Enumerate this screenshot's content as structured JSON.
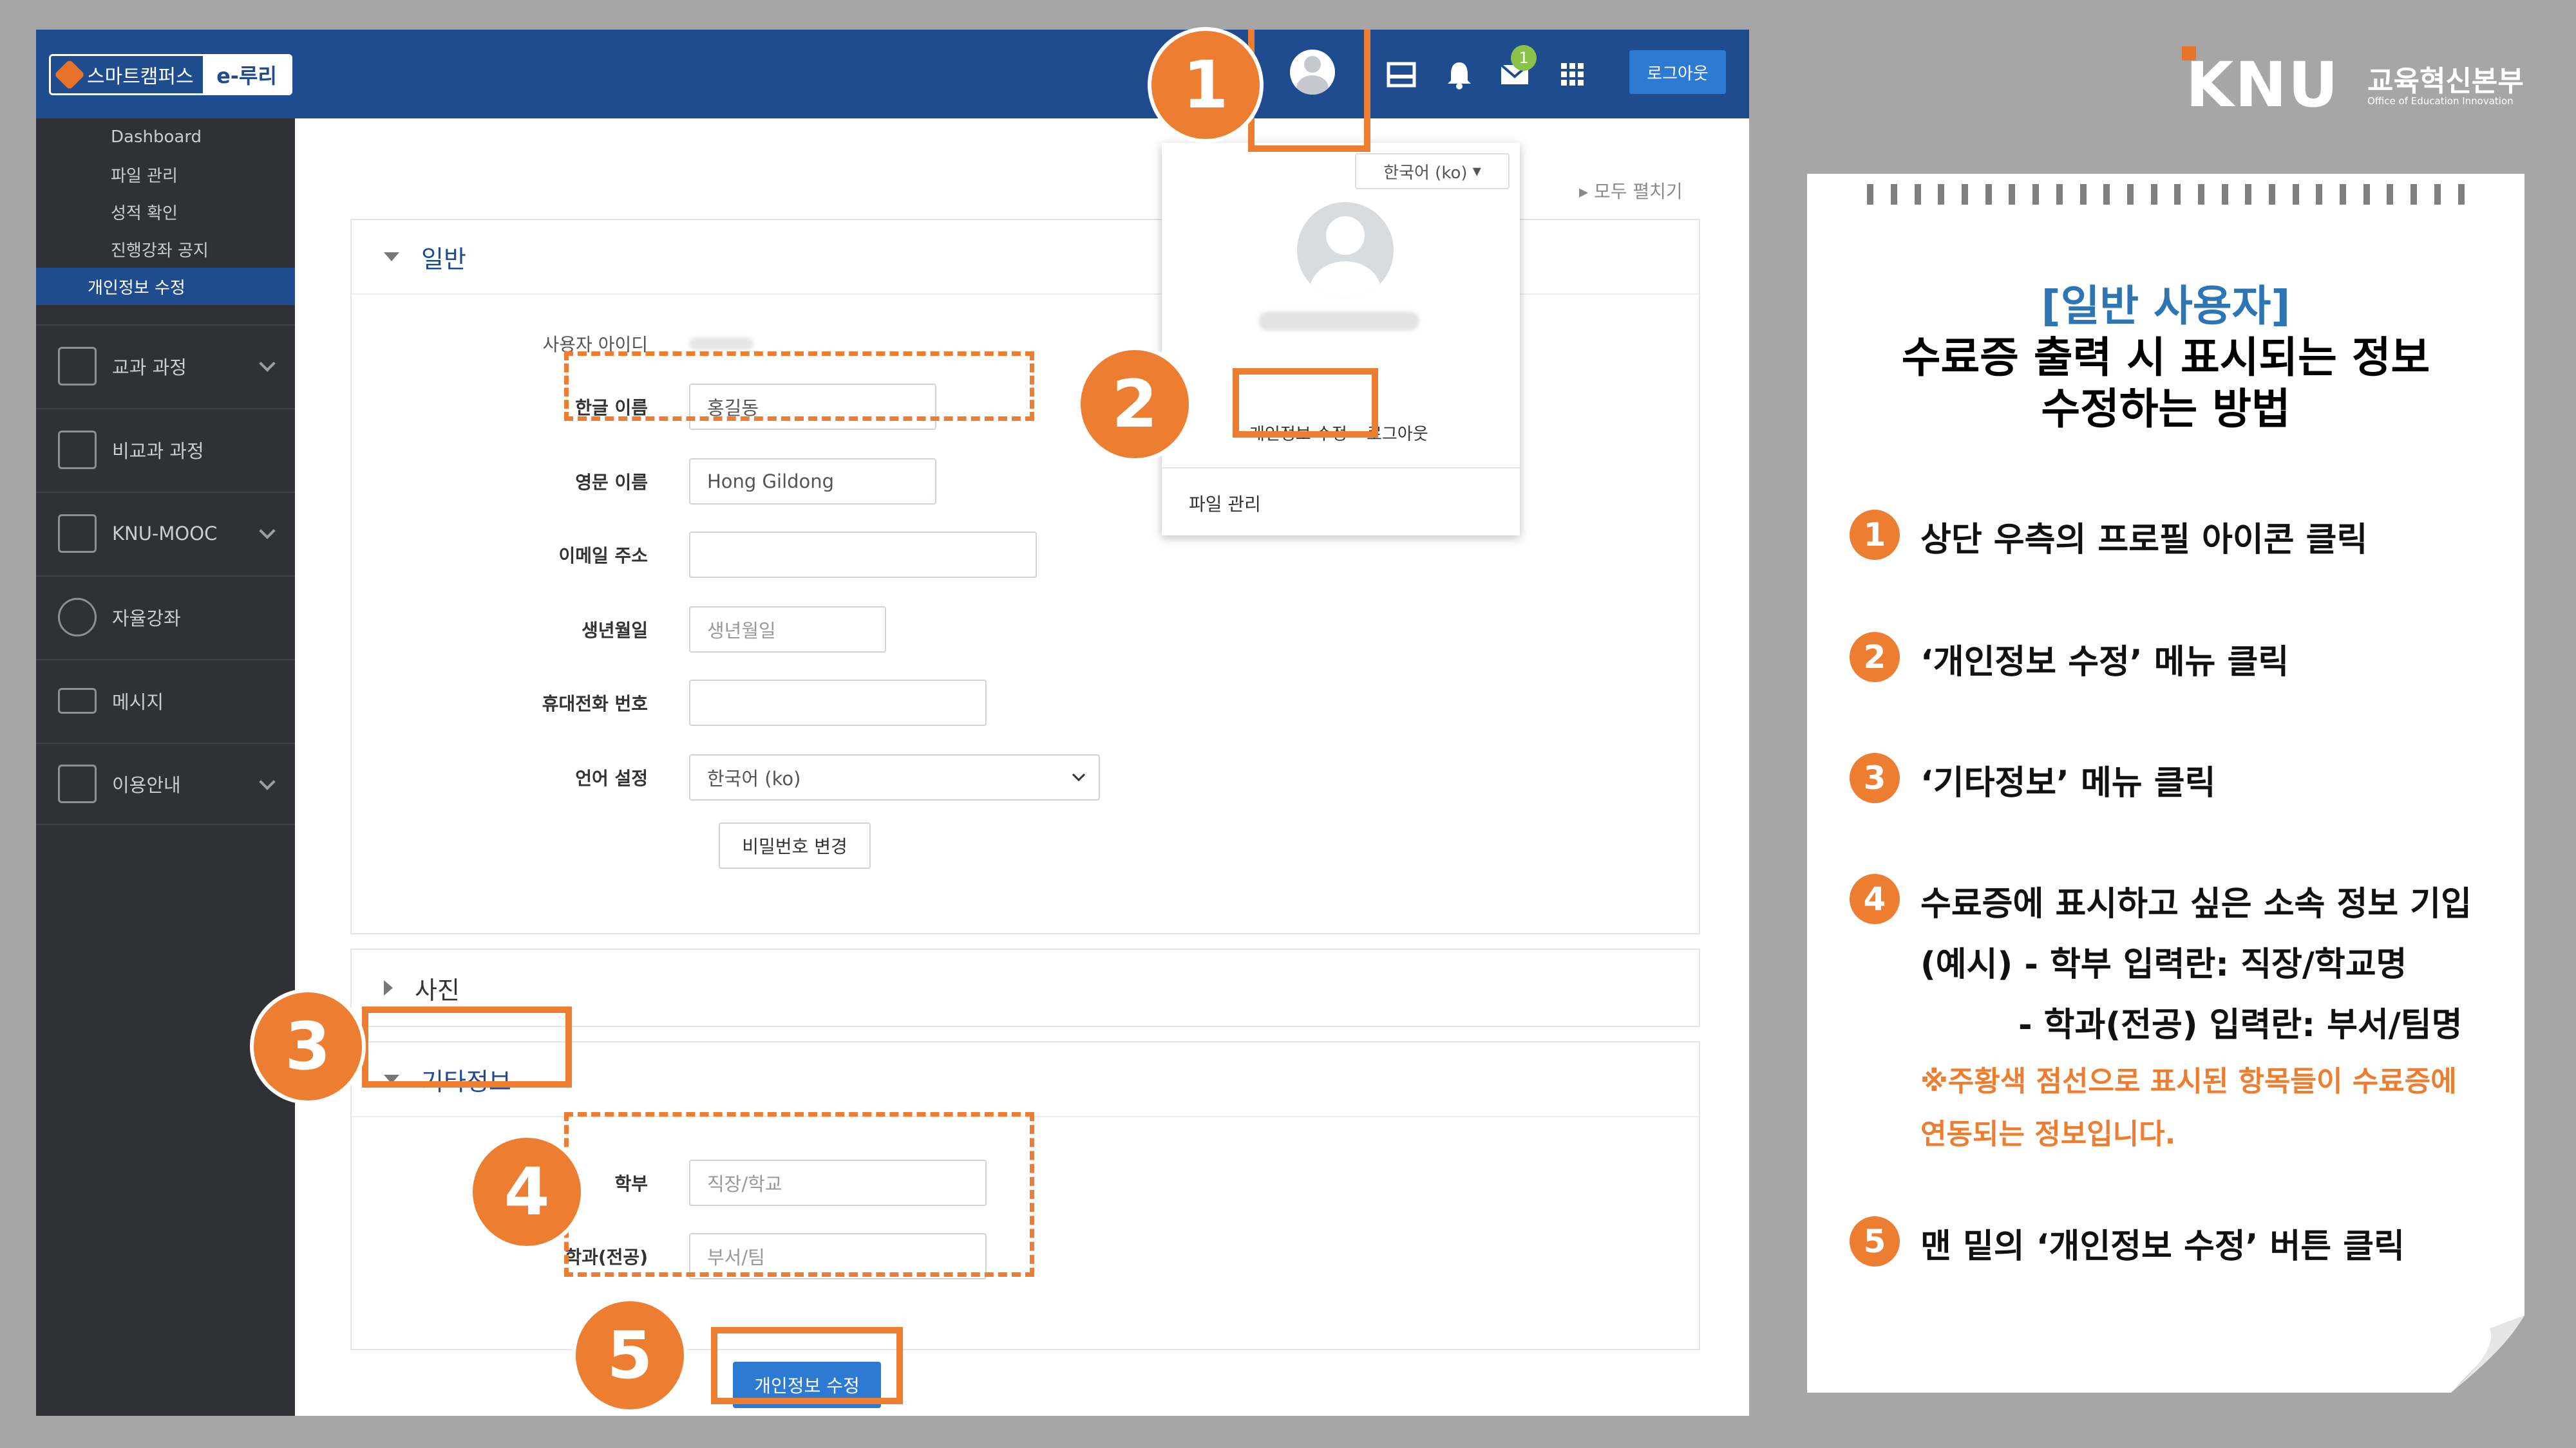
{
  "header": {
    "logo_text": "스마트캠퍼스",
    "logo_brand": "e-루리",
    "logout_label": "로그아웃",
    "message_badge": "1"
  },
  "sidebar": {
    "sub_items": [
      {
        "label": "Dashboard"
      },
      {
        "label": "파일 관리"
      },
      {
        "label": "성적 확인"
      },
      {
        "label": "진행강좌 공지"
      },
      {
        "label": "개인정보 수정",
        "active": true
      }
    ],
    "nav_items": [
      {
        "label": "교과 과정",
        "icon": "book-icon",
        "expandable": true
      },
      {
        "label": "비교과 과정",
        "icon": "open-book-icon",
        "expandable": false
      },
      {
        "label": "KNU-MOOC",
        "icon": "monitor-icon",
        "expandable": true
      },
      {
        "label": "자율강좌",
        "icon": "people-icon",
        "expandable": false
      },
      {
        "label": "메시지",
        "icon": "envelope-icon",
        "expandable": false
      },
      {
        "label": "이용안내",
        "icon": "map-icon",
        "expandable": true
      }
    ]
  },
  "main": {
    "expand_all": "모두 펼치기",
    "section_general": "일반",
    "section_photo": "사진",
    "section_other": "기타정보",
    "fields": {
      "user_id_label": "사용자 아이디",
      "korean_name_label": "한글 이름",
      "korean_name_value": "홍길동",
      "english_name_label": "영문 이름",
      "english_name_value": "Hong Gildong",
      "email_label": "이메일 주소",
      "birthday_label": "생년월일",
      "birthday_placeholder": "생년월일",
      "phone_label": "휴대전화 번호",
      "language_label": "언어 설정",
      "language_value": "한국어 (ko)",
      "password_button": "비밀번호 변경",
      "dept_label": "학부",
      "dept_placeholder": "직장/학교",
      "major_label": "학과(전공)",
      "major_placeholder": "부서/팀"
    },
    "save_button": "개인정보 수정"
  },
  "dropdown": {
    "language": "한국어 (ko)",
    "edit_profile": "개인정보 수정",
    "logout": "로그아웃",
    "file_manage": "파일 관리"
  },
  "callouts": [
    "1",
    "2",
    "3",
    "4",
    "5"
  ],
  "brand": {
    "logo": "KNU",
    "name_kr": "교육혁신본부",
    "name_en": "Office of Education Innovation"
  },
  "guide": {
    "subtitle": "[일반 사용자]",
    "title_line1": "수료증 출력 시 표시되는 정보",
    "title_line2": "수정하는 방법",
    "steps": [
      {
        "num": "1",
        "text": "상단 우측의 프로필 아이콘 클릭"
      },
      {
        "num": "2",
        "text": "‘개인정보 수정’ 메뉴 클릭"
      },
      {
        "num": "3",
        "text": "‘기타정보’ 메뉴 클릭"
      },
      {
        "num": "4",
        "text": "수료증에 표시하고 싶은 소속 정보 기입"
      },
      {
        "num": "5",
        "text": "맨 밑의 ‘개인정보 수정’ 버튼 클릭"
      }
    ],
    "example_line1": "(예시) - 학부 입력란: 직장/학교명",
    "example_line2": "- 학과(전공) 입력란: 부서/팀명",
    "note_line1": "※주황색 점선으로 표시된 항목들이 수료증에",
    "note_line2": "연동되는 정보입니다."
  },
  "colors": {
    "header_blue": "#1e4c8f",
    "accent_orange": "#ed7d31",
    "button_blue": "#2d7ad3",
    "sidebar_dark": "#2f3135",
    "subtitle_blue": "#2e75b6"
  }
}
